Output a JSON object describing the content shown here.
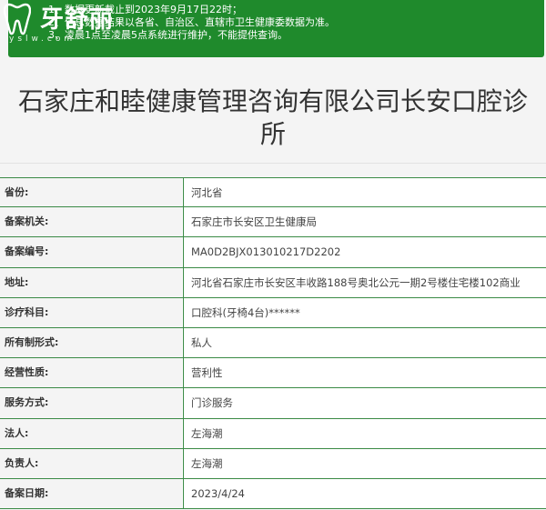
{
  "notice": {
    "lines": [
      "1、数据更新截止到2023年9月17日22时；",
      "2、信息数据结果以各省、自治区、直辖市卫生健康委数据为准。",
      "3、凌晨1点至凌晨5点系统进行维护，不能提供查询。"
    ]
  },
  "logo": {
    "brand": "牙舒丽",
    "sub": "yslw.com"
  },
  "title": "石家庄和睦健康管理咨询有限公司长安口腔诊所",
  "rows": [
    {
      "label": "省份:",
      "value": "河北省"
    },
    {
      "label": "备案机关:",
      "value": "石家庄市长安区卫生健康局"
    },
    {
      "label": "备案编号:",
      "value": "MA0D2BJX013010217D2202"
    },
    {
      "label": "地址:",
      "value": "河北省石家庄市长安区丰收路188号奥北公元一期2号楼住宅楼102商业"
    },
    {
      "label": "诊疗科目:",
      "value": "口腔科(牙椅4台)******"
    },
    {
      "label": "所有制形式:",
      "value": "私人"
    },
    {
      "label": "经营性质:",
      "value": "营利性"
    },
    {
      "label": "服务方式:",
      "value": "门诊服务"
    },
    {
      "label": "法人:",
      "value": "左海潮"
    },
    {
      "label": "负责人:",
      "value": "左海潮"
    },
    {
      "label": "备案日期:",
      "value": "2023/4/24"
    }
  ]
}
